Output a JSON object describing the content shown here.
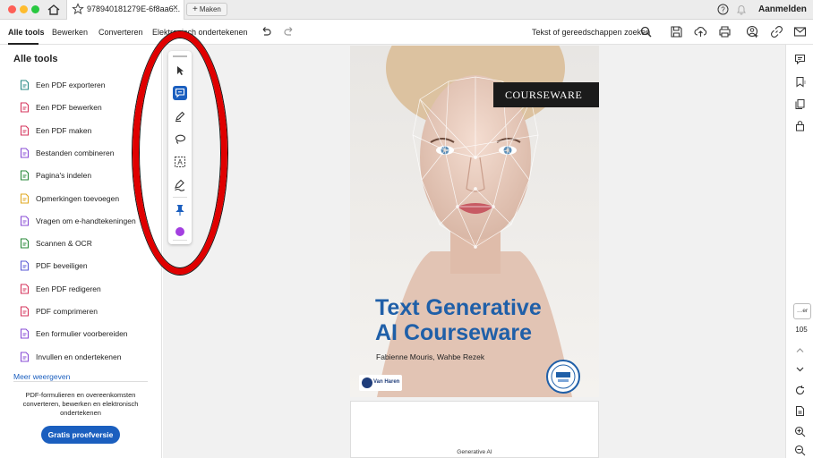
{
  "window": {
    "tab_title": "978940181279E-6f8aa6...",
    "tab_close": "×",
    "maken_label": "Maken",
    "login_label": "Aanmelden"
  },
  "menu": {
    "items": [
      "Alle tools",
      "Bewerken",
      "Converteren",
      "Elektronisch ondertekenen"
    ],
    "search_placeholder": "Tekst of gereedschappen zoeken"
  },
  "left_panel": {
    "title": "Alle tools",
    "tools": [
      {
        "label": "Een PDF exporteren",
        "icon": "export-pdf-icon",
        "color": "#2a8a86"
      },
      {
        "label": "Een PDF bewerken",
        "icon": "edit-pdf-icon",
        "color": "#d6355c"
      },
      {
        "label": "Een PDF maken",
        "icon": "create-pdf-icon",
        "color": "#d6355c"
      },
      {
        "label": "Bestanden combineren",
        "icon": "combine-files-icon",
        "color": "#8a4ed6"
      },
      {
        "label": "Pagina's indelen",
        "icon": "organize-pages-icon",
        "color": "#2a8a3a"
      },
      {
        "label": "Opmerkingen toevoegen",
        "icon": "comment-icon",
        "color": "#e0a820"
      },
      {
        "label": "Vragen om e-handtekeningen",
        "icon": "request-signature-icon",
        "color": "#8a4ed6"
      },
      {
        "label": "Scannen & OCR",
        "icon": "scan-ocr-icon",
        "color": "#2a8a3a"
      },
      {
        "label": "PDF beveiligen",
        "icon": "protect-pdf-icon",
        "color": "#5a5ad6"
      },
      {
        "label": "Een PDF redigeren",
        "icon": "redact-pdf-icon",
        "color": "#d6355c"
      },
      {
        "label": "PDF comprimeren",
        "icon": "compress-pdf-icon",
        "color": "#d6355c"
      },
      {
        "label": "Een formulier voorbereiden",
        "icon": "prepare-form-icon",
        "color": "#8a4ed6"
      },
      {
        "label": "Invullen en ondertekenen",
        "icon": "fill-sign-icon",
        "color": "#8a4ed6"
      }
    ],
    "more_label": "Meer weergeven",
    "promo_text": "PDF-formulieren en overeenkomsten converteren, bewerken en elektronisch ondertekenen",
    "trial_label": "Gratis proefversie"
  },
  "document": {
    "cover_badge": "COURSEWARE",
    "cover_title_line1": "Text Generative",
    "cover_title_line2": "AI Courseware",
    "cover_authors": "Fabienne Mouris, Wahbe Rezek",
    "publisher": "Van Haren",
    "next_page_text": "Generative AI"
  },
  "right_rail": {
    "zoom_label": "…er",
    "page_number": "105"
  },
  "colors": {
    "accent": "#1b5fbf",
    "annotation_ring": "#e00000",
    "cover_title": "#1f5fa8"
  }
}
